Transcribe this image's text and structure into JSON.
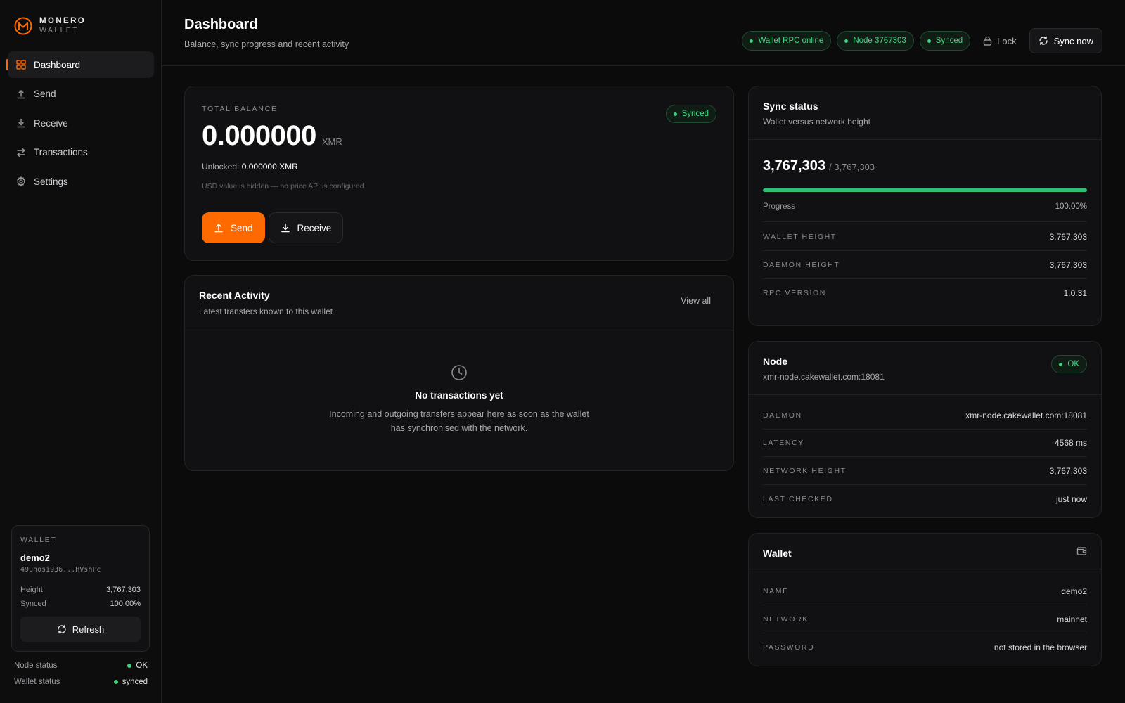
{
  "brand": {
    "name": "MONERO",
    "sub": "WALLET"
  },
  "nav": [
    {
      "label": "Dashboard",
      "icon": "dashboard-icon",
      "active": true
    },
    {
      "label": "Send",
      "icon": "upload-icon"
    },
    {
      "label": "Receive",
      "icon": "download-icon"
    },
    {
      "label": "Transactions",
      "icon": "swap-icon"
    },
    {
      "label": "Settings",
      "icon": "gear-icon"
    }
  ],
  "sidebar_wallet": {
    "label": "WALLET",
    "name": "demo2",
    "address": "49unosi936...HVshPc",
    "height_label": "Height",
    "height_value": "3,767,303",
    "synced_label": "Synced",
    "synced_value": "100.00%",
    "refresh_label": "Refresh"
  },
  "side_status": {
    "node_label": "Node status",
    "node_value": "OK",
    "wallet_label": "Wallet status",
    "wallet_value": "synced"
  },
  "header": {
    "title": "Dashboard",
    "subtitle": "Balance, sync progress and recent activity",
    "pills": [
      "Wallet RPC online",
      "Node 3767303",
      "Synced"
    ],
    "lock_label": "Lock",
    "sync_label": "Sync now"
  },
  "balance": {
    "label": "TOTAL BALANCE",
    "amount": "0.000000",
    "unit": "XMR",
    "unlocked_label": "Unlocked:",
    "unlocked_value": "0.000000 XMR",
    "note": "USD value is hidden — no price API is configured.",
    "badge": "Synced",
    "send_label": "Send",
    "receive_label": "Receive"
  },
  "activity": {
    "title": "Recent Activity",
    "subtitle": "Latest transfers known to this wallet",
    "view_all": "View all",
    "empty_title": "No transactions yet",
    "empty_text_1": "Incoming and outgoing transfers appear here as soon as the wallet",
    "empty_text_2": "has synchronised with the network."
  },
  "sync": {
    "title": "Sync status",
    "subtitle": "Wallet versus network height",
    "height": "3,767,303",
    "network": "/ 3,767,303",
    "progress_label": "Progress",
    "progress_value": "100.00%",
    "progress_fraction": 1.0,
    "rows": [
      {
        "k": "WALLET HEIGHT",
        "v": "3,767,303"
      },
      {
        "k": "DAEMON HEIGHT",
        "v": "3,767,303"
      },
      {
        "k": "RPC VERSION",
        "v": "1.0.31"
      }
    ]
  },
  "node": {
    "title": "Node",
    "subtitle": "xmr-node.cakewallet.com:18081",
    "badge": "OK",
    "rows": [
      {
        "k": "DAEMON",
        "v": "xmr-node.cakewallet.com:18081"
      },
      {
        "k": "LATENCY",
        "v": "4568 ms"
      },
      {
        "k": "NETWORK HEIGHT",
        "v": "3,767,303"
      },
      {
        "k": "LAST CHECKED",
        "v": "just now"
      }
    ]
  },
  "wallet_info": {
    "title": "Wallet",
    "rows": [
      {
        "k": "NAME",
        "v": "demo2"
      },
      {
        "k": "NETWORK",
        "v": "mainnet"
      },
      {
        "k": "PASSWORD",
        "v": "not stored in the browser"
      }
    ]
  },
  "colors": {
    "accent": "#ff6a00",
    "success": "#45d585",
    "background": "#0b0b0c",
    "card": "#111113"
  }
}
